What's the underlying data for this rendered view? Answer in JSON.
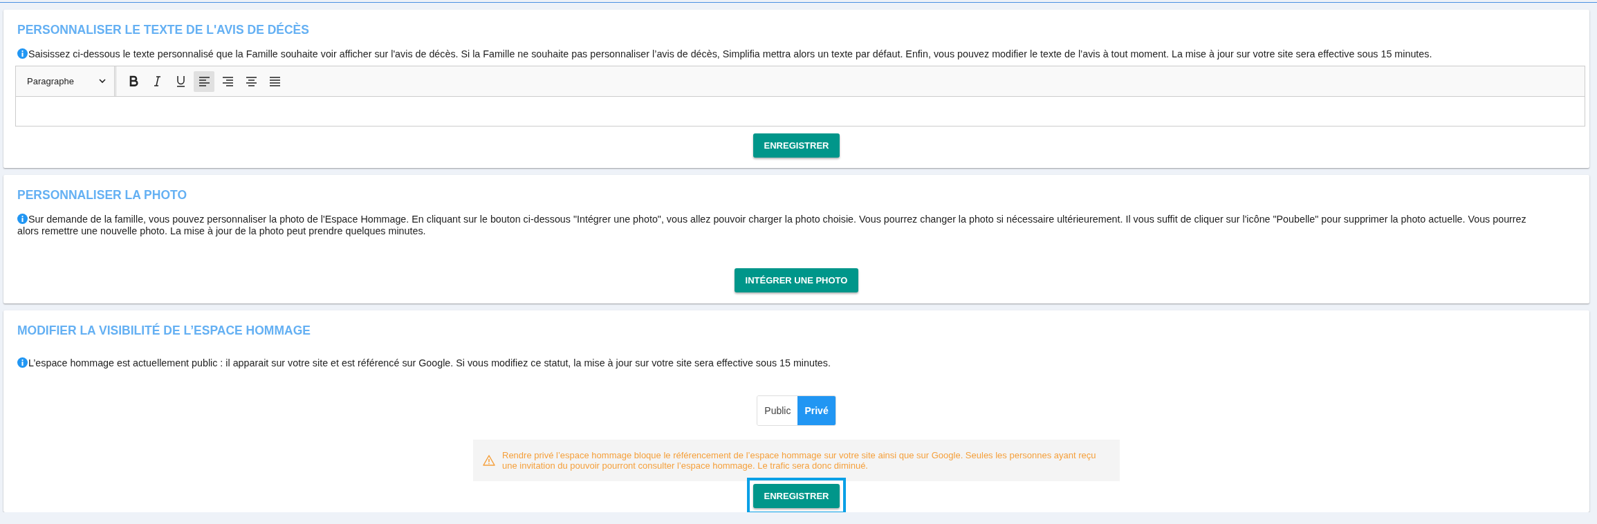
{
  "sections": [
    {
      "kind": "editor",
      "title": "PERSONNALISER LE TEXTE DE L'AVIS DE DÉCÈS",
      "info": "Saisissez ci-dessous le texte personnalisé que la Famille souhaite voir afficher sur l'avis de décès. Si la Famille ne souhaite pas personnaliser l’avis de décès, Simplifia mettra alors un texte par défaut. Enfin, vous pouvez modifier le texte de l’avis à tout moment. La mise à jour sur votre site sera effective sous 15 minutes.",
      "editor": {
        "format": "Paragraphe",
        "tools": [
          {
            "kind": "bold",
            "selected": false
          },
          {
            "kind": "italic",
            "selected": false
          },
          {
            "kind": "underline",
            "selected": false
          },
          {
            "kind": "align-left",
            "selected": true
          },
          {
            "kind": "align-right",
            "selected": false
          },
          {
            "kind": "align-center",
            "selected": false
          },
          {
            "kind": "justify",
            "selected": false
          }
        ]
      },
      "button": {
        "label": "ENREGISTRER",
        "focused": false
      }
    },
    {
      "kind": "photo",
      "title": "PERSONNALISER LA PHOTO",
      "info": "Sur demande de la famille, vous pouvez personnaliser la photo de l'Espace Hommage. En cliquant sur le bouton ci-dessous \"Intégrer une photo\", vous allez pouvoir charger la photo choisie. Vous pourrez changer la photo si nécessaire ultérieurement. Il vous suffit de cliquer sur l'icône \"Poubelle\" pour supprimer la photo actuelle. Vous pourrez alors remettre une nouvelle photo. La mise à jour de la photo peut prendre quelques minutes.",
      "button": {
        "label": "INTÉGRER UNE PHOTO",
        "focused": false
      }
    },
    {
      "kind": "visibility",
      "title": "MODIFIER LA VISIBILITÉ DE L’ESPACE HOMMAGE",
      "info": "L’espace hommage est actuellement public : il apparait sur votre site et est référencé sur Google. Si vous modifiez ce statut, la mise à jour sur votre site sera effective sous 15 minutes.",
      "options": [
        {
          "label": "Public",
          "selected": false
        },
        {
          "label": "Privé",
          "selected": true
        }
      ],
      "warning": "Rendre privé l’espace hommage bloque le référencement de l’espace hommage sur votre site ainsi que sur Google. Seules les personnes ayant reçu une invitation du pouvoir pourront consulter l’espace hommage. Le trafic sera donc diminué.",
      "button": {
        "label": "ENREGISTRER",
        "focused": true
      }
    }
  ]
}
